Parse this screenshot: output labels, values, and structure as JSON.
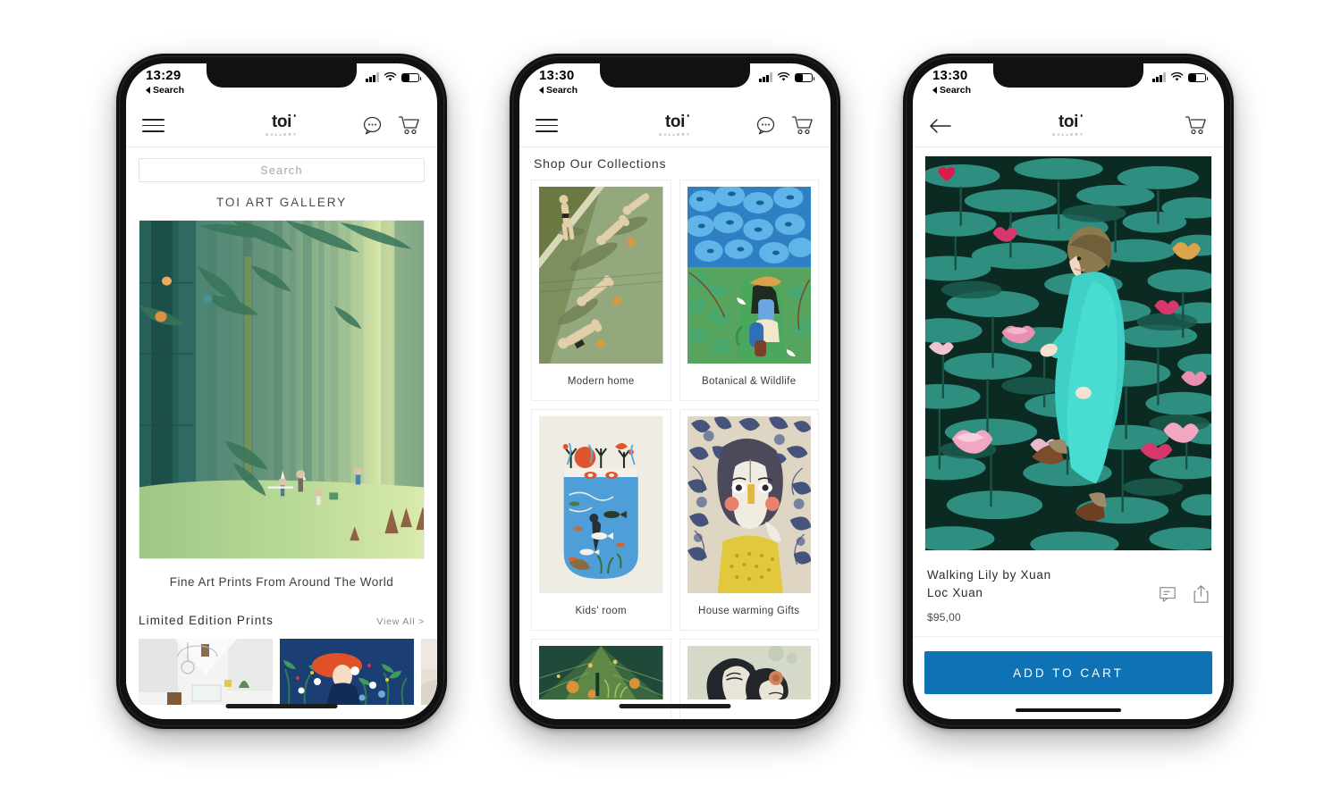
{
  "brand": {
    "logo_text": "toi",
    "logo_sub": "GALLERY",
    "accent_color": "#0F72B5",
    "heart_color": "#E0194B"
  },
  "phones": [
    {
      "id": "home",
      "status": {
        "time": "13:29",
        "back_label": "Search",
        "signal": "signal-icon",
        "wifi": "wifi-icon",
        "battery": "battery-icon"
      },
      "header": {
        "menu": "hamburger-icon",
        "chat": "chat-bubble-icon",
        "cart": "cart-icon"
      },
      "search": {
        "placeholder": "Search",
        "value": ""
      },
      "brandline": "TOI ART GALLERY",
      "hero_alt": "bamboo-forest-illustration",
      "tagline": "Fine Art Prints From Around The World",
      "section": {
        "title": "Limited Edition Prints",
        "view_all": "View All >"
      },
      "thumbnails": [
        "white-interior-print",
        "red-haired-woman-floral-print",
        "beige-print"
      ]
    },
    {
      "id": "collections",
      "status": {
        "time": "13:30",
        "back_label": "Search"
      },
      "header": {
        "menu": "hamburger-icon",
        "chat": "chat-bubble-icon",
        "cart": "cart-icon"
      },
      "title": "Shop Our Collections",
      "collections": [
        {
          "label": "Modern home",
          "art": "divers-olive"
        },
        {
          "label": "Botanical & Wildlife",
          "art": "monstera-blue"
        },
        {
          "label": "Kids' room",
          "art": "aquarium-blue"
        },
        {
          "label": "House warming Gifts",
          "art": "woman-indigo-floral"
        },
        {
          "label": "",
          "art": "greenhouse-teal"
        },
        {
          "label": "",
          "art": "mother-child-sage"
        }
      ]
    },
    {
      "id": "product",
      "status": {
        "time": "13:30",
        "back_label": "Search"
      },
      "header": {
        "back": "arrow-left-icon",
        "cart": "cart-icon"
      },
      "product": {
        "image_alt": "walking-lily-lotus-pond",
        "favorite": "heart-icon",
        "title": "Walking Lily by Xuan Loc Xuan",
        "title_line1": "Walking Lily by Xuan",
        "title_line2": "Loc Xuan",
        "price": "$95,00",
        "review_icon": "comment-icon",
        "share_icon": "share-icon",
        "cta_label": "ADD TO CART"
      }
    }
  ]
}
